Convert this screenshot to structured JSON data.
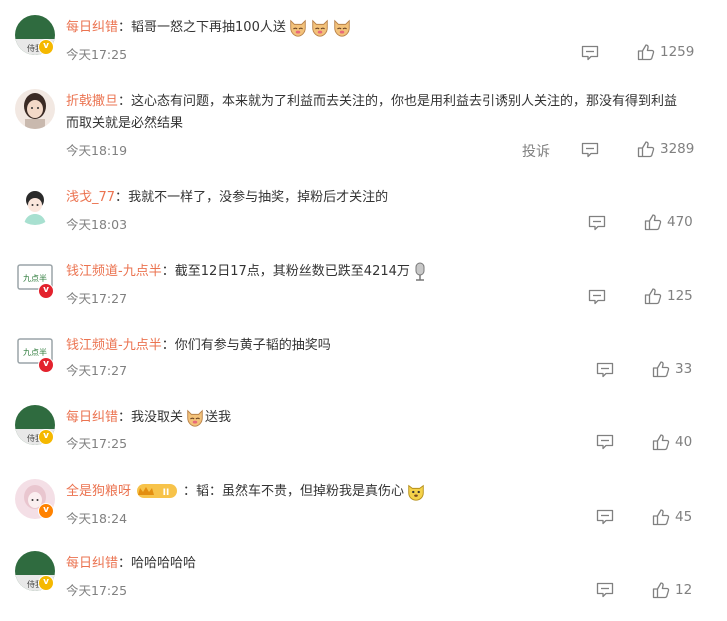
{
  "colors": {
    "username": "#eb7350",
    "text": "#333333",
    "meta": "#808080",
    "gold_badge": "#f5b800",
    "red_badge": "#e3222d",
    "orange_badge": "#ff8200"
  },
  "comments": [
    {
      "username": "每日纠错",
      "colon": "：",
      "text": "韬哥一怒之下再抽100人送",
      "time": "今天17:25",
      "likes": "1259",
      "badge": "gold",
      "avatar": "green-avatar"
    },
    {
      "username": "折戟撒旦",
      "colon": "：",
      "text": "这心态有问题，本来就为了利益而去关注的，你也是用利益去引诱别人关注的，那没有得到利益而取关就是必然结果",
      "time": "今天18:19",
      "likes": "3289",
      "report": "投诉",
      "avatar": "girl-avatar"
    },
    {
      "username": "浅戈_77",
      "colon": "：",
      "text": "我就不一样了，没参与抽奖，掉粉后才关注的",
      "time": "今天18:03",
      "likes": "470",
      "avatar": "cartoon-avatar"
    },
    {
      "username": "钱江频道-九点半",
      "colon": "：",
      "text": "截至12日17点，其粉丝数已跌至4214万",
      "time": "今天17:27",
      "likes": "125",
      "badge": "red",
      "avatar": "channel-avatar"
    },
    {
      "username": "钱江频道-九点半",
      "colon": "：",
      "text": "你们有参与黄子韬的抽奖吗",
      "time": "今天17:27",
      "likes": "33",
      "badge": "red",
      "avatar": "channel-avatar"
    },
    {
      "username": "每日纠错",
      "colon": "：",
      "text": "我没取关",
      "text2": "送我",
      "time": "今天17:25",
      "likes": "40",
      "badge": "gold",
      "avatar": "green-avatar"
    },
    {
      "username": "全是狗粮呀",
      "colon": "：",
      "text": "韬：虽然车不贵，但掉粉我是真伤心",
      "time": "今天18:24",
      "likes": "45",
      "badge": "orange",
      "vip": "II",
      "avatar": "pink-avatar"
    },
    {
      "username": "每日纠错",
      "colon": "：",
      "text": "哈哈哈哈哈",
      "time": "今天17:25",
      "likes": "12",
      "badge": "gold",
      "avatar": "green-avatar"
    }
  ]
}
